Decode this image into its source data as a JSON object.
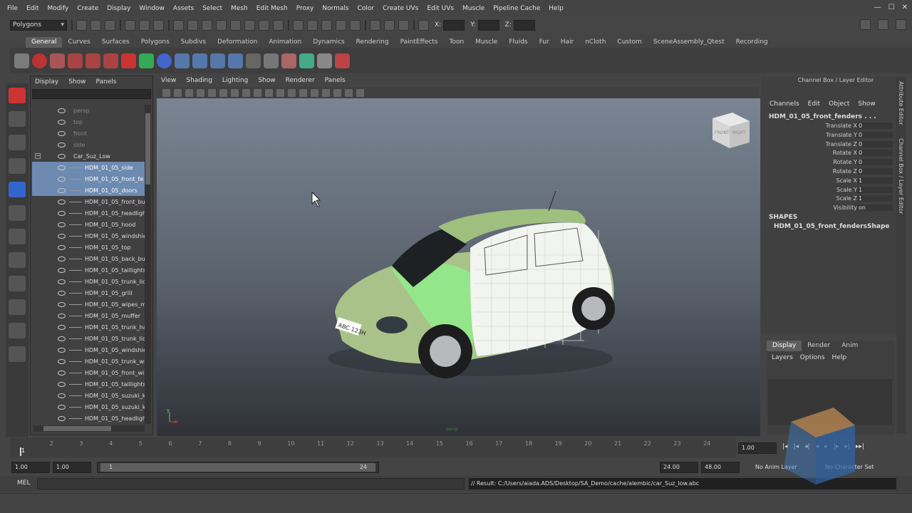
{
  "menubar": {
    "items": [
      "File",
      "Edit",
      "Modify",
      "Create",
      "Display",
      "Window",
      "Assets",
      "Select",
      "Mesh",
      "Edit Mesh",
      "Proxy",
      "Normals",
      "Color",
      "Create UVs",
      "Edit UVs",
      "Muscle",
      "Pipeline Cache",
      "Help"
    ]
  },
  "status_line": {
    "mode": "Polygons",
    "x_label": "X:",
    "y_label": "Y:",
    "z_label": "Z:"
  },
  "shelf": {
    "tabs": [
      "General",
      "Curves",
      "Surfaces",
      "Polygons",
      "Subdivs",
      "Deformation",
      "Animation",
      "Dynamics",
      "Rendering",
      "PaintEffects",
      "Toon",
      "Muscle",
      "Fluids",
      "Fur",
      "Hair",
      "nCloth",
      "Custom",
      "SceneAssembly_Qtest",
      "Recording"
    ],
    "active_tab": "General"
  },
  "outliner": {
    "menu": [
      "Display",
      "Show",
      "Panels"
    ],
    "items": [
      {
        "label": "persp",
        "style": "dim",
        "indent": 0
      },
      {
        "label": "top",
        "style": "dim",
        "indent": 0
      },
      {
        "label": "front",
        "style": "dim",
        "indent": 0
      },
      {
        "label": "side",
        "style": "dim",
        "indent": 0
      },
      {
        "label": "Car_Suz_Low",
        "style": "group",
        "indent": 0,
        "expander": "−"
      },
      {
        "label": "HDM_01_05_side",
        "style": "sel",
        "indent": 1
      },
      {
        "label": "HDM_01_05_front_fe",
        "style": "sel",
        "indent": 1
      },
      {
        "label": "HDM_01_05_doors",
        "style": "sel",
        "indent": 1
      },
      {
        "label": "HDM_01_05_front_bu",
        "style": "normal",
        "indent": 1
      },
      {
        "label": "HDM_01_05_headligh",
        "style": "normal",
        "indent": 1
      },
      {
        "label": "HDM_01_05_hood",
        "style": "normal",
        "indent": 1
      },
      {
        "label": "HDM_01_05_windshie",
        "style": "normal",
        "indent": 1
      },
      {
        "label": "HDM_01_05_top",
        "style": "normal",
        "indent": 1
      },
      {
        "label": "HDM_01_05_back_bu",
        "style": "normal",
        "indent": 1
      },
      {
        "label": "HDM_01_05_taillights",
        "style": "normal",
        "indent": 1
      },
      {
        "label": "HDM_01_05_trunk_lid",
        "style": "normal",
        "indent": 1
      },
      {
        "label": "HDM_01_05_grill",
        "style": "normal",
        "indent": 1
      },
      {
        "label": "HDM_01_05_wipes_m",
        "style": "normal",
        "indent": 1
      },
      {
        "label": "HDM_01_05_muffer",
        "style": "normal",
        "indent": 1
      },
      {
        "label": "HDM_01_05_trunk_ha",
        "style": "normal",
        "indent": 1
      },
      {
        "label": "HDM_01_05_trunk_lid",
        "style": "normal",
        "indent": 1
      },
      {
        "label": "HDM_01_05_windshie",
        "style": "normal",
        "indent": 1
      },
      {
        "label": "HDM_01_05_trunk_wi",
        "style": "normal",
        "indent": 1
      },
      {
        "label": "HDM_01_05_front_wi",
        "style": "normal",
        "indent": 1
      },
      {
        "label": "HDM_01_05_taillights",
        "style": "normal",
        "indent": 1
      },
      {
        "label": "HDM_01_05_suzuki_k",
        "style": "normal",
        "indent": 1
      },
      {
        "label": "HDM_01_05_suzuki_k",
        "style": "normal",
        "indent": 1
      },
      {
        "label": "HDM_01_05_headligh",
        "style": "normal",
        "indent": 1
      }
    ]
  },
  "viewport": {
    "menu": [
      "View",
      "Shading",
      "Lighting",
      "Show",
      "Renderer",
      "Panels"
    ],
    "viewcube_front": "FRONT",
    "viewcube_right": "RIGHT",
    "plate_text": "ABC 123H",
    "axis_x": "x",
    "axis_y": "y",
    "camera_label": "persp"
  },
  "channel_box": {
    "title": "Channel Box / Layer Editor",
    "menu": [
      "Channels",
      "Edit",
      "Object",
      "Show"
    ],
    "object_name": "HDM_01_05_front_fenders . . .",
    "attributes": [
      {
        "name": "Translate X",
        "value": "0"
      },
      {
        "name": "Translate Y",
        "value": "0"
      },
      {
        "name": "Translate Z",
        "value": "0"
      },
      {
        "name": "Rotate X",
        "value": "0"
      },
      {
        "name": "Rotate Y",
        "value": "0"
      },
      {
        "name": "Rotate Z",
        "value": "0"
      },
      {
        "name": "Scale X",
        "value": "1"
      },
      {
        "name": "Scale Y",
        "value": "1"
      },
      {
        "name": "Scale Z",
        "value": "1"
      },
      {
        "name": "Visibility",
        "value": "on"
      }
    ],
    "shapes_header": "SHAPES",
    "shape_name": "HDM_01_05_front_fendersShape",
    "side_tabs": [
      "Attribute Editor",
      "Channel Box / Layer Editor"
    ]
  },
  "layer_editor": {
    "tabs": [
      "Display",
      "Render",
      "Anim"
    ],
    "active_tab": "Display",
    "menu": [
      "Layers",
      "Options",
      "Help"
    ]
  },
  "time_slider": {
    "ticks": [
      "1",
      "2",
      "3",
      "4",
      "5",
      "6",
      "7",
      "8",
      "9",
      "10",
      "11",
      "12",
      "13",
      "14",
      "15",
      "16",
      "17",
      "18",
      "19",
      "20",
      "21",
      "22",
      "23",
      "24"
    ],
    "current_frame": "1",
    "current_time_field": "1.00"
  },
  "range_slider": {
    "start_time": "1.00",
    "playback_start": "1.00",
    "range_start_label": "1",
    "range_end_label": "24",
    "playback_end": "24.00",
    "end_time": "48.00",
    "anim_layer": "No Anim Layer",
    "character_set": "No Character Set"
  },
  "command_line": {
    "mel_label": "MEL",
    "result": "// Result: C:/Users/aiada.ADS/Desktop/SA_Demo/cache/alembic/car_Suz_low.abc"
  }
}
